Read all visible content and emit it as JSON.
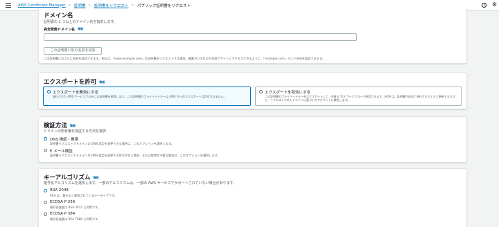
{
  "breadcrumbs": {
    "items": [
      "AWS Certificate Manager",
      "証明書",
      "証明書をリクエスト"
    ],
    "current": "パブリック証明書をリクエスト"
  },
  "domain_section": {
    "title": "ドメイン名",
    "description": "証明書の 1 つ以上のドメイン名を指定します。",
    "field_label": "完全修飾ドメイン名",
    "info": "情報",
    "input_value": "",
    "add_button": "この証明書に別の名前を追加",
    "hint": "この証明書にはさらに名前を追加できます。例えば、「www.example.com」の証明書をリクエストする場合、顧客がいずれかの名前でサイトにアクセスできるように、「example.com」という名前を追加できます。"
  },
  "export_section": {
    "title": "エクスポートを許可",
    "info": "情報",
    "options": [
      {
        "title": "エクスポートを無効にする",
        "description": "発行された AWS サービスでのみこの証明書を使用します。この証明書のプライベートキーは AWS からのエクスポートは許可されません。",
        "selected": true
      },
      {
        "title": "エクスポートを有効にする",
        "description": "この証明書のプライベートキーをエクスポートして、任意の TLS ワークフローで使用できます。ACM は、証明書が初めて発行されたときと更新するたびに、リクエストされたドメインに基づいてアカウントに課金します。",
        "selected": false
      }
    ]
  },
  "method_section": {
    "title": "検証方法",
    "info": "情報",
    "description": "ドメインの所有権を検証する方法を選択",
    "options": [
      {
        "title": "DNS 検証 - 推奨",
        "description": "証明書リクエストでドメインの DNS 設定を変更できる場合は、このオプションを選択します。",
        "selected": true
      },
      {
        "title": "E メール検証",
        "description": "証明書リクエストでドメインの DNS 設定を変更する許可がない場合、または取得が不要な場合は、このオプションを選択します。",
        "selected": false
      }
    ]
  },
  "algorithm_section": {
    "title": "キーアルゴリズム",
    "info": "情報",
    "description": "暗号化アルゴリズムを選択します。一部のアルゴリズムは、一部の AWS サービスでサポートされていない場合があります。",
    "options": [
      {
        "title": "RSA 2048",
        "description": "RSA は、最も広く使用されているキータイプです。",
        "selected": true
      },
      {
        "title": "ECDSA P 256",
        "description": "暗号化強度は RSA 3072 と同等です。",
        "selected": false
      },
      {
        "title": "ECDSA P 384",
        "description": "暗号化強度は RSA 7680 と同等です。",
        "selected": false
      }
    ]
  },
  "colors": {
    "accent": "#0073bb",
    "page_background": "#f2f3f3",
    "text": "#16191f",
    "muted_text": "#545b64"
  },
  "icons": {
    "menu": "hamburger-menu-icon",
    "info": "info-circle-icon",
    "settings": "gear-icon"
  }
}
